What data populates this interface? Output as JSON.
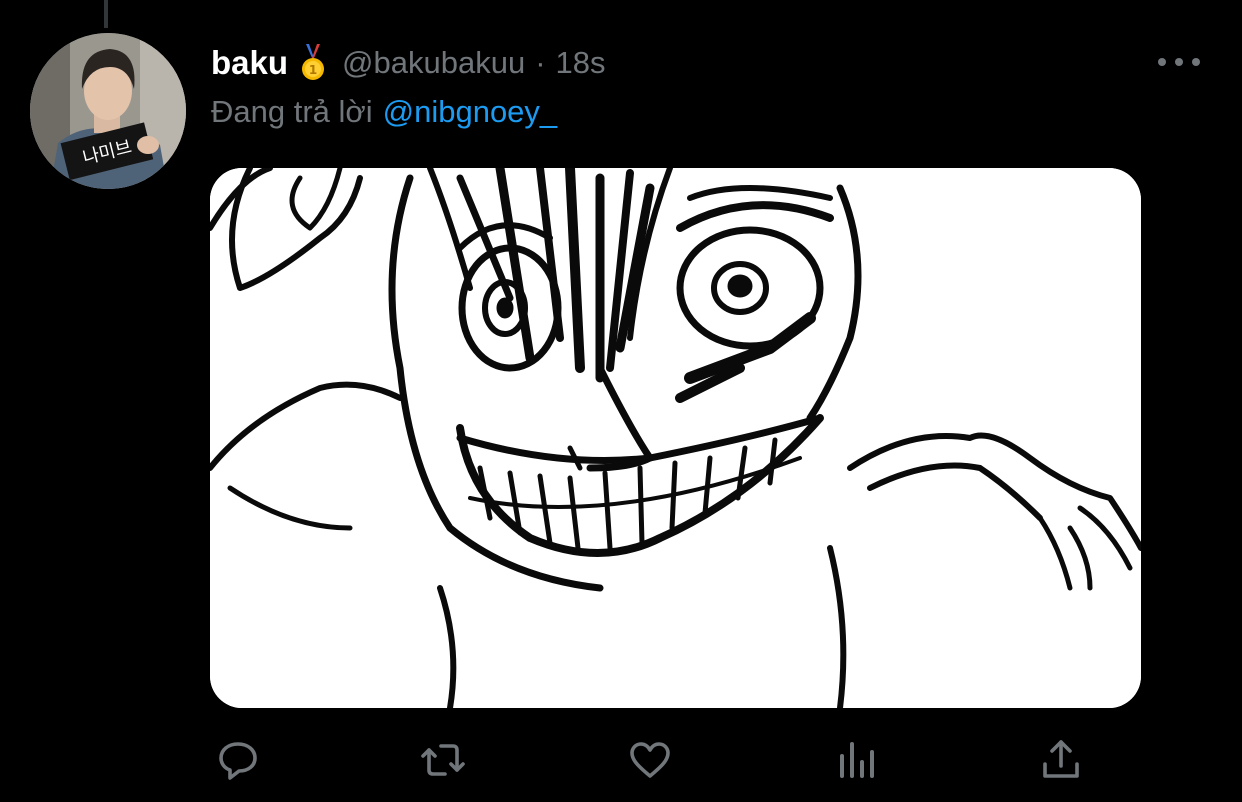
{
  "tweet": {
    "display_name": "baku",
    "badge_icon": "gold-medal-icon",
    "handle": "@bakubakuu",
    "separator": "·",
    "time": "18s",
    "reply_prefix": "Đang trả lời",
    "reply_to": "@nibgnoey_"
  },
  "avatar": {
    "sign_text": "나미브"
  },
  "actions": [
    {
      "name": "reply",
      "icon": "reply-icon"
    },
    {
      "name": "retweet",
      "icon": "retweet-icon"
    },
    {
      "name": "like",
      "icon": "heart-icon"
    },
    {
      "name": "analytics",
      "icon": "analytics-icon"
    },
    {
      "name": "share",
      "icon": "share-icon"
    }
  ],
  "colors": {
    "background": "#000000",
    "primary_text": "#ffffff",
    "secondary_text": "#71767b",
    "link": "#1d9bf0"
  }
}
